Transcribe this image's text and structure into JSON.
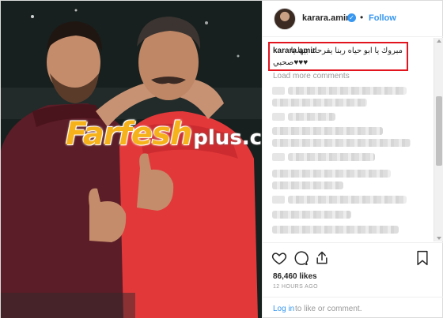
{
  "post": {
    "username": "karara.amir",
    "follow_label": "Follow",
    "separator": "•",
    "verified_glyph": "✓"
  },
  "watermark": {
    "main": "Farfesh",
    "suffix": "plus.com"
  },
  "caption": {
    "username": "karara.amir",
    "text": "مبروك يا ابو حياه ربنا يفرحك بيها يا",
    "text_line2": "صحبي♥♥♥"
  },
  "comments": {
    "load_more": "Load more comments"
  },
  "actions": {
    "likes": "86,460 likes",
    "time": "12 HOURS AGO",
    "login_link": "Log in",
    "login_rest": "to like or comment."
  },
  "icons": {
    "heart": "heart-icon",
    "comment": "comment-icon",
    "share": "share-icon",
    "save": "bookmark-icon",
    "verified": "verified-badge-icon"
  },
  "colors": {
    "accent_blue": "#3897f0",
    "highlight_red": "#e2141d",
    "watermark_gold": "#f6b21b"
  }
}
